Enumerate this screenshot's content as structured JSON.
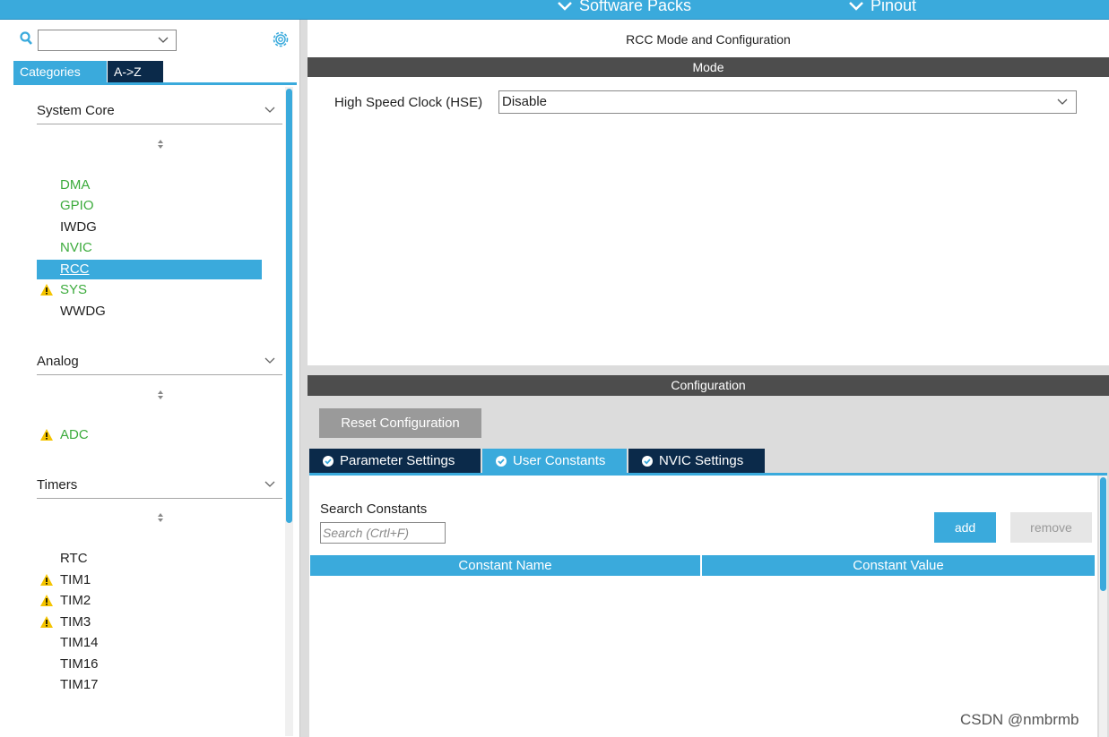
{
  "topbar": {
    "items": [
      {
        "label": "Software Packs",
        "icon": "chevron-down-icon"
      },
      {
        "label": "Pinout",
        "icon": "chevron-down-icon"
      }
    ]
  },
  "sidebar": {
    "search": {
      "value": "",
      "icon": "search-icon"
    },
    "settings_icon": "gear-icon",
    "view_tabs": [
      {
        "label": "Categories",
        "active": true
      },
      {
        "label": "A->Z",
        "active": false
      }
    ],
    "categories": [
      {
        "label": "System Core",
        "items": [
          {
            "label": "DMA",
            "color": "green",
            "warning": false,
            "selected": false
          },
          {
            "label": "GPIO",
            "color": "green",
            "warning": false,
            "selected": false
          },
          {
            "label": "IWDG",
            "color": "black",
            "warning": false,
            "selected": false
          },
          {
            "label": "NVIC",
            "color": "green",
            "warning": false,
            "selected": false
          },
          {
            "label": "RCC",
            "color": "white",
            "warning": false,
            "selected": true
          },
          {
            "label": "SYS",
            "color": "green",
            "warning": true,
            "selected": false
          },
          {
            "label": "WWDG",
            "color": "black",
            "warning": false,
            "selected": false
          }
        ]
      },
      {
        "label": "Analog",
        "items": [
          {
            "label": "ADC",
            "color": "green",
            "warning": true,
            "selected": false
          }
        ]
      },
      {
        "label": "Timers",
        "items": [
          {
            "label": "RTC",
            "color": "black",
            "warning": false,
            "selected": false
          },
          {
            "label": "TIM1",
            "color": "black",
            "warning": true,
            "selected": false
          },
          {
            "label": "TIM2",
            "color": "black",
            "warning": true,
            "selected": false
          },
          {
            "label": "TIM3",
            "color": "black",
            "warning": true,
            "selected": false
          },
          {
            "label": "TIM14",
            "color": "black",
            "warning": false,
            "selected": false
          },
          {
            "label": "TIM16",
            "color": "black",
            "warning": false,
            "selected": false
          },
          {
            "label": "TIM17",
            "color": "black",
            "warning": false,
            "selected": false
          }
        ]
      }
    ]
  },
  "main": {
    "title": "RCC Mode and Configuration",
    "mode": {
      "header": "Mode",
      "hse_label": "High Speed Clock (HSE)",
      "hse_value": "Disable"
    },
    "configuration": {
      "header": "Configuration",
      "reset_label": "Reset Configuration",
      "tabs": [
        {
          "label": "Parameter Settings",
          "active": false,
          "icon": "check-circle-icon"
        },
        {
          "label": "User Constants",
          "active": true,
          "icon": "check-circle-icon"
        },
        {
          "label": "NVIC Settings",
          "active": false,
          "icon": "check-circle-icon"
        }
      ],
      "search_label": "Search Constants",
      "search_placeholder": "Search (Crtl+F)",
      "add_label": "add",
      "remove_label": "remove",
      "columns": [
        "Constant Name",
        "Constant Value"
      ]
    }
  },
  "watermark": "CSDN @nmbrmb",
  "colors": {
    "accent": "#3aaadc",
    "dark_header": "#4d4d4d",
    "dark_tab": "#0b2a4a",
    "ip_green": "#3cab3c",
    "warning": "#f5c400"
  }
}
